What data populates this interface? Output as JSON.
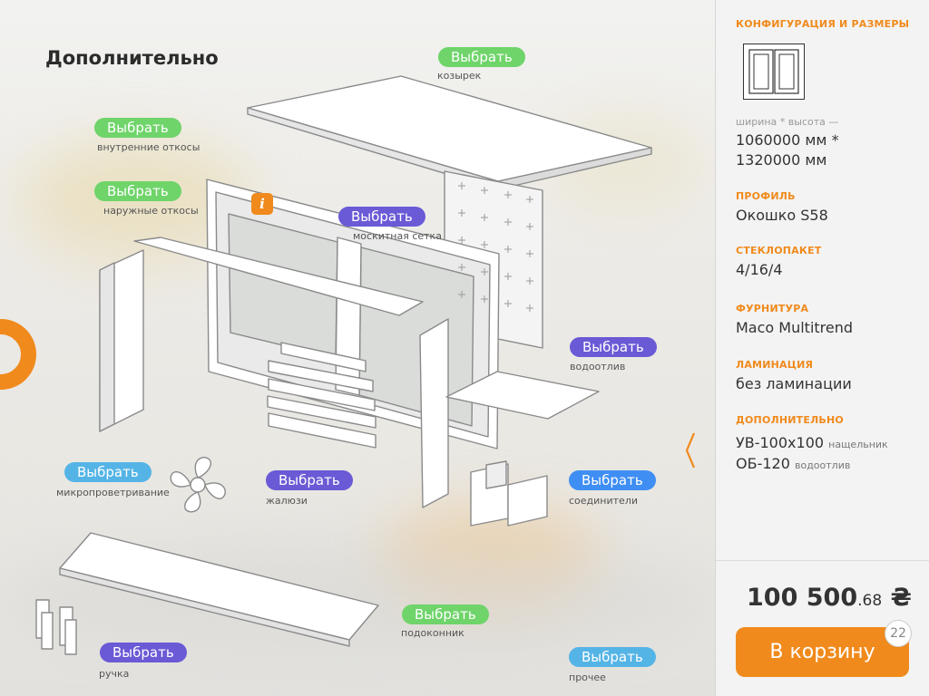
{
  "page": {
    "title": "Дополнительно"
  },
  "options": [
    {
      "id": "kozyrek",
      "button": "Выбрать",
      "caption": "козырек",
      "color": "#6fd46a"
    },
    {
      "id": "vnutr",
      "button": "Выбрать",
      "caption": "внутренние откосы",
      "color": "#6fd46a"
    },
    {
      "id": "naruzh",
      "button": "Выбрать",
      "caption": "наружные откосы",
      "color": "#6fd46a"
    },
    {
      "id": "setka",
      "button": "Выбрать",
      "caption": "москитная сетка",
      "color": "#6a5ad6"
    },
    {
      "id": "vodootliv",
      "button": "Выбрать",
      "caption": "водоотлив",
      "color": "#6a5ad6"
    },
    {
      "id": "mikro",
      "button": "Выбрать",
      "caption": "микропроветривание",
      "color": "#55b4e6"
    },
    {
      "id": "zhaluzi",
      "button": "Выбрать",
      "caption": "жалюзи",
      "color": "#6a5ad6"
    },
    {
      "id": "soed",
      "button": "Выбрать",
      "caption": "соединители",
      "color": "#3f8ef3"
    },
    {
      "id": "podokonnik",
      "button": "Выбрать",
      "caption": "подоконник",
      "color": "#6fd46a"
    },
    {
      "id": "ruchka",
      "button": "Выбрать",
      "caption": "ручка",
      "color": "#6a5ad6"
    },
    {
      "id": "prochee",
      "button": "Выбрать",
      "caption": "прочее",
      "color": "#55b4e6"
    }
  ],
  "info_icon": "i",
  "sidebar": {
    "config_heading": "КОНФИГУРАЦИЯ И РАЗМЕРЫ",
    "dims_label": "ширина * высота —",
    "dims_line1": "1060000 мм *",
    "dims_line2": "1320000 мм",
    "profile_heading": "ПРОФИЛЬ",
    "profile_value": "Окошко S58",
    "glass_heading": "СТЕКЛОПАКЕТ",
    "glass_value": "4/16/4",
    "hardware_heading": "ФУРНИТУРА",
    "hardware_value": "Maco Multitrend",
    "lamination_heading": "ЛАМИНАЦИЯ",
    "lamination_value": "без ламинации",
    "extra_heading": "ДОПОЛНИТЕЛЬНО",
    "extra_items": [
      {
        "code": "УВ-100х100",
        "note": "нащельник"
      },
      {
        "code": "ОБ-120",
        "note": "водоотлив"
      }
    ],
    "price_main": "100 500",
    "price_cents": ".68",
    "currency": "₴",
    "cart_label": "В корзину",
    "cart_count": "22"
  },
  "colors": {
    "accent": "#f08a1c",
    "green": "#6fd46a",
    "violet": "#6a5ad6",
    "blue": "#3f8ef3",
    "sky": "#55b4e6"
  }
}
